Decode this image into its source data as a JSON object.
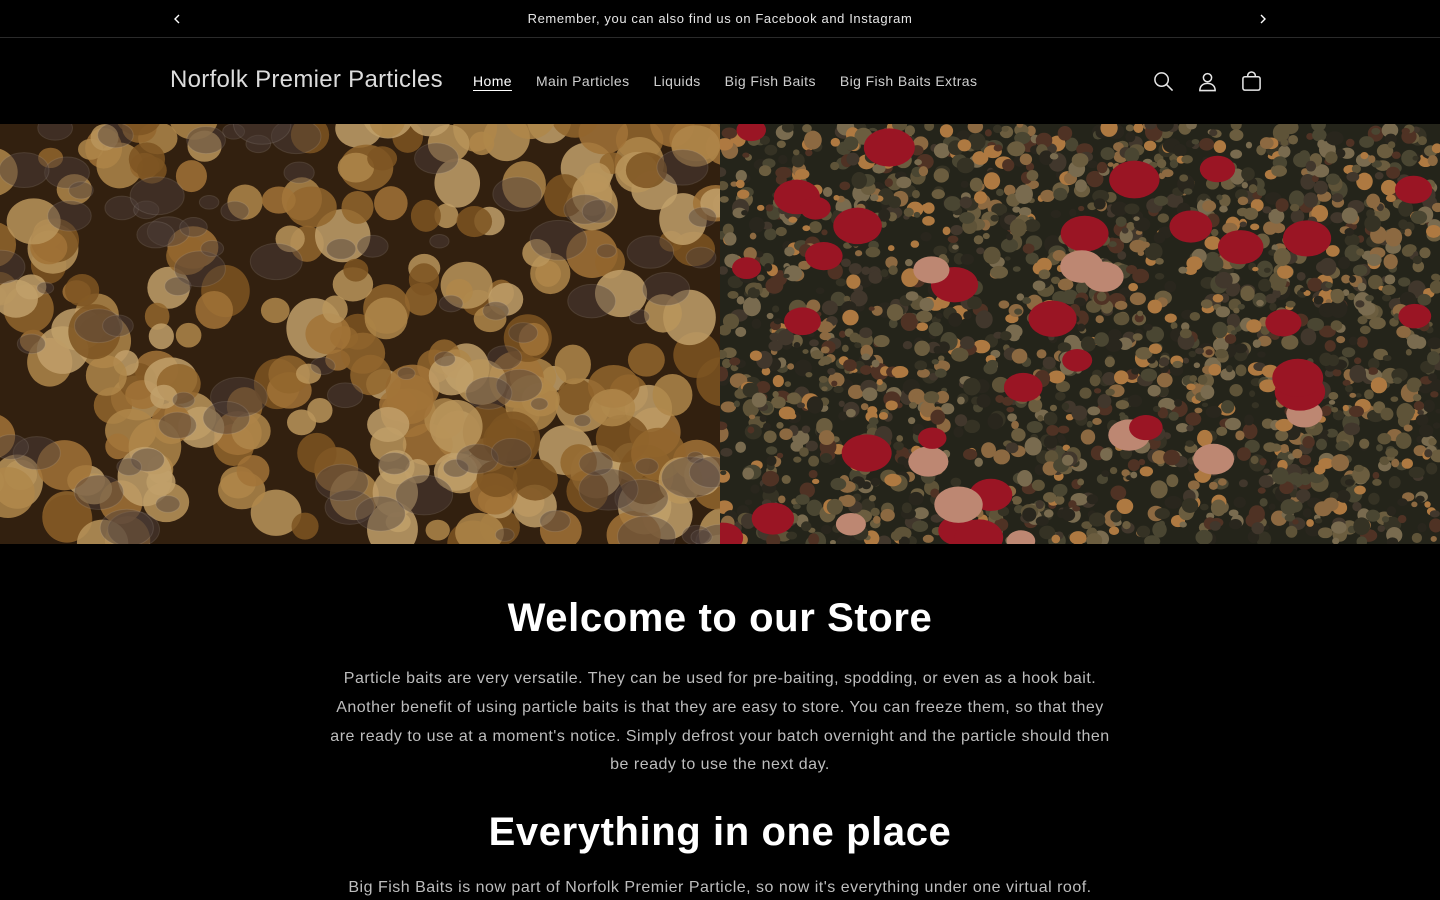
{
  "announcement": {
    "text": "Remember, you can also find us on Facebook and Instagram",
    "prev_icon": "chevron-left-icon",
    "next_icon": "chevron-right-icon"
  },
  "header": {
    "logo": "Norfolk Premier Particles",
    "nav": [
      {
        "label": "Home",
        "active": true
      },
      {
        "label": "Main Particles",
        "active": false
      },
      {
        "label": "Liquids",
        "active": false
      },
      {
        "label": "Big Fish Baits",
        "active": false
      },
      {
        "label": "Big Fish Baits Extras",
        "active": false
      }
    ],
    "icons": [
      "search-icon",
      "account-icon",
      "cart-icon"
    ]
  },
  "hero": {
    "images": [
      "soaked-tiger-nuts-image",
      "mixed-particle-seeds-image"
    ]
  },
  "content": {
    "welcome_heading": "Welcome to our Store",
    "welcome_text": "Particle baits are very versatile. They can be used for pre-baiting, spodding, or even as a hook bait. Another benefit of using particle baits is that they are easy to store. You can freeze them, so that they are ready to use at a moment's notice. Simply defrost your batch overnight and the particle should then be ready to use the next day.",
    "everything_heading": "Everything in one place",
    "everything_text": "Big Fish Baits is now part of Norfolk Premier Particle, so now it's everything under one virtual roof."
  },
  "colors": {
    "background": "#000000",
    "text": "#ffffff",
    "muted_text": "#bdbdbd"
  }
}
